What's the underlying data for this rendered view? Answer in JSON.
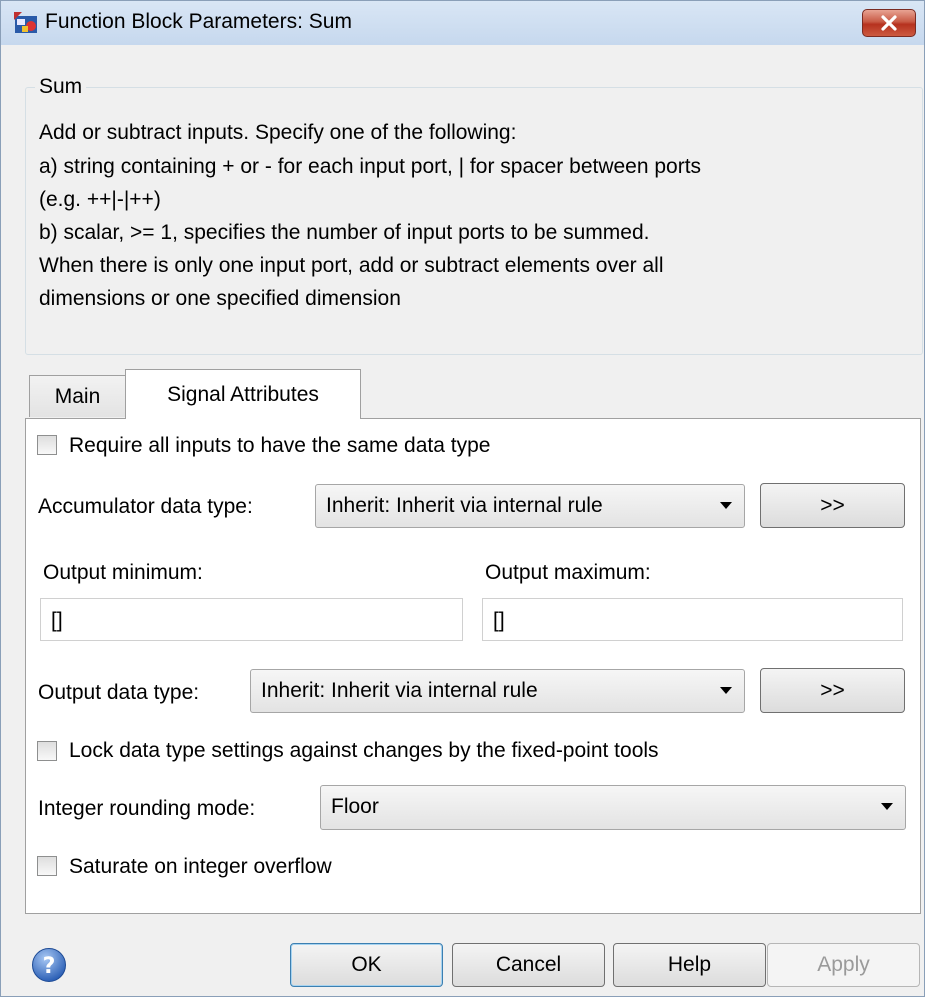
{
  "window": {
    "title": "Function Block Parameters: Sum",
    "close_icon": "close-icon"
  },
  "description": {
    "group_label": "Sum",
    "lines": [
      "Add or subtract inputs.  Specify one of the following:",
      "a) string containing + or - for each input port, | for spacer between ports",
      "(e.g. ++|-|++)",
      "b) scalar, >= 1, specifies the number of input ports to be summed.",
      "When there is only one input port, add or subtract elements over all",
      "dimensions or one specified dimension"
    ]
  },
  "tabs": [
    {
      "label": "Main",
      "selected": false
    },
    {
      "label": "Signal Attributes",
      "selected": true
    }
  ],
  "signal_attributes": {
    "require_same_type": {
      "label": "Require all inputs to have the same data type",
      "checked": false
    },
    "accumulator": {
      "label": "Accumulator data type:",
      "value": "Inherit: Inherit via internal rule",
      "button": ">>"
    },
    "output_min": {
      "label": "Output minimum:",
      "value": "[]"
    },
    "output_max": {
      "label": "Output maximum:",
      "value": "[]"
    },
    "output_type": {
      "label": "Output data type:",
      "value": "Inherit: Inherit via internal rule",
      "button": ">>"
    },
    "lock_types": {
      "label": "Lock data type settings against changes by the fixed-point tools",
      "checked": false
    },
    "rounding": {
      "label": "Integer rounding mode:",
      "value": "Floor"
    },
    "saturate": {
      "label": "Saturate on integer overflow",
      "checked": false
    }
  },
  "footer": {
    "help_icon": "help-icon",
    "ok": "OK",
    "cancel": "Cancel",
    "help": "Help",
    "apply": "Apply"
  }
}
